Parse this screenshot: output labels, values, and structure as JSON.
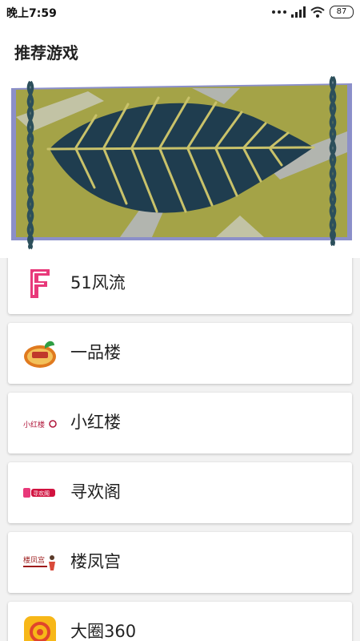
{
  "status_bar": {
    "time": "晚上7:59",
    "battery": "87",
    "icons": [
      "more-dots-icon",
      "signal-icon",
      "wifi-icon",
      "battery-icon"
    ]
  },
  "header": {
    "title": "推荐游戏"
  },
  "banner": {
    "image": "leaf-illustration",
    "colors": {
      "olive": "#a4a347",
      "leaf": "#1f3d4f",
      "frame": "#8b8fc9",
      "chain": "#2c4f5b"
    }
  },
  "list": {
    "items": [
      {
        "label": "51风流",
        "icon": "letter-f-logo-icon"
      },
      {
        "label": "一品楼",
        "icon": "yipinlou-logo-icon"
      },
      {
        "label": "小红楼",
        "icon": "xiaohonglou-logo-icon",
        "logo_text": "小红楼"
      },
      {
        "label": "寻欢阁",
        "icon": "xunhuange-logo-icon",
        "logo_text": "寻欢阁"
      },
      {
        "label": "楼凤宫",
        "icon": "loufenggong-logo-icon",
        "logo_text": "楼凤宫"
      },
      {
        "label": "大圈360",
        "icon": "daquan-camera-logo-icon"
      }
    ]
  }
}
